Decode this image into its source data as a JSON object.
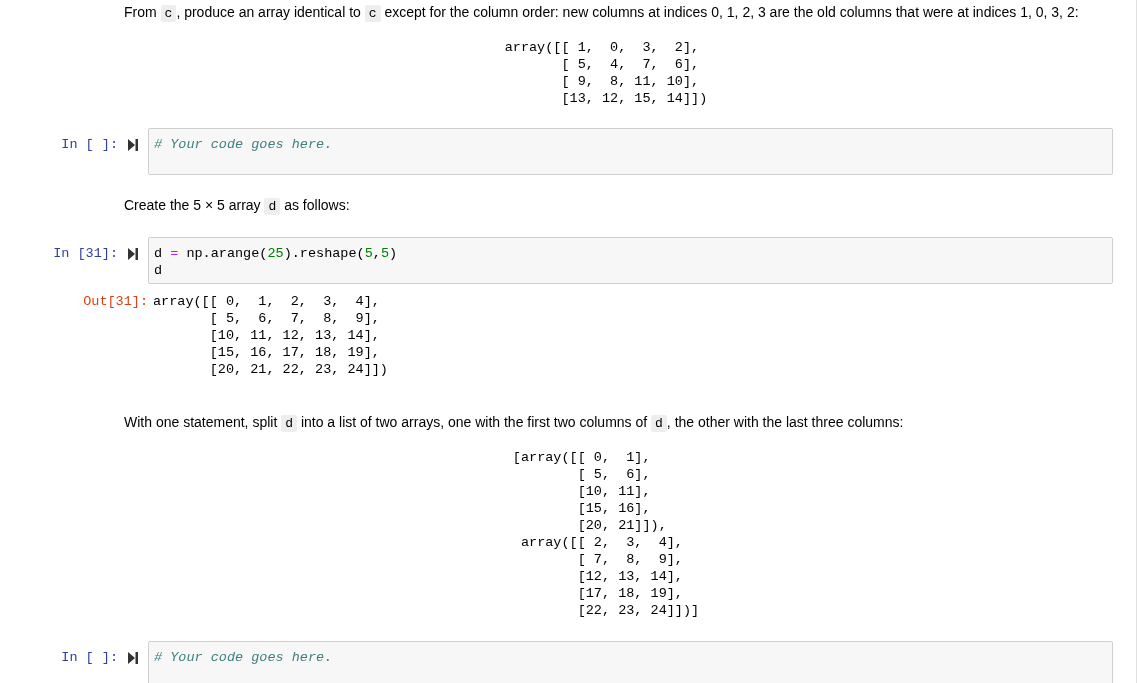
{
  "cells": [
    {
      "kind": "markdown",
      "parts": [
        {
          "kind": "text",
          "text": "From "
        },
        {
          "kind": "code",
          "text": "c"
        },
        {
          "kind": "text",
          "text": ", produce an array identical to "
        },
        {
          "kind": "code",
          "text": "c"
        },
        {
          "kind": "text",
          "text": " except for the column order: new columns at indices 0, 1, 2, 3 are the old columns that were at indices 1, 0, 3, 2:"
        }
      ],
      "block": [
        "array([[ 1,  0,  3,  2],",
        "       [ 5,  4,  7,  6],",
        "       [ 9,  8, 11, 10],",
        "       [13, 12, 15, 14]])"
      ]
    },
    {
      "kind": "code",
      "prompt": "In [ ]:",
      "lines": [
        [
          {
            "kind": "comment",
            "text": "# Your code goes here."
          }
        ]
      ]
    },
    {
      "kind": "markdown",
      "parts": [
        {
          "kind": "text",
          "text": "Create the 5 × 5 array "
        },
        {
          "kind": "code",
          "text": "d"
        },
        {
          "kind": "text",
          "text": " as follows:"
        }
      ]
    },
    {
      "kind": "code",
      "prompt": "In [31]:",
      "lines": [
        [
          {
            "kind": "plain",
            "text": "d "
          },
          {
            "kind": "op",
            "text": "="
          },
          {
            "kind": "plain",
            "text": " np.arange("
          },
          {
            "kind": "number",
            "text": "25"
          },
          {
            "kind": "plain",
            "text": ").reshape("
          },
          {
            "kind": "number",
            "text": "5"
          },
          {
            "kind": "plain",
            "text": ","
          },
          {
            "kind": "number",
            "text": "5"
          },
          {
            "kind": "plain",
            "text": ")"
          }
        ],
        [
          {
            "kind": "plain",
            "text": "d"
          }
        ]
      ]
    },
    {
      "kind": "output",
      "prompt": "Out[31]:",
      "lines": [
        "array([[ 0,  1,  2,  3,  4],",
        "       [ 5,  6,  7,  8,  9],",
        "       [10, 11, 12, 13, 14],",
        "       [15, 16, 17, 18, 19],",
        "       [20, 21, 22, 23, 24]])"
      ]
    },
    {
      "kind": "markdown",
      "parts": [
        {
          "kind": "text",
          "text": "With one statement, split "
        },
        {
          "kind": "code",
          "text": "d"
        },
        {
          "kind": "text",
          "text": " into a list of two arrays, one with the first two columns of "
        },
        {
          "kind": "code",
          "text": "d"
        },
        {
          "kind": "text",
          "text": ", the other with the last three columns:"
        }
      ],
      "block": [
        "[array([[ 0,  1],",
        "        [ 5,  6],",
        "        [10, 11],",
        "        [15, 16],",
        "        [20, 21]]),",
        " array([[ 2,  3,  4],",
        "        [ 7,  8,  9],",
        "        [12, 13, 14],",
        "        [17, 18, 19],",
        "        [22, 23, 24]])]"
      ]
    },
    {
      "kind": "code",
      "prompt": "In [ ]:",
      "lines": [
        [
          {
            "kind": "comment",
            "text": "# Your code goes here."
          }
        ]
      ]
    }
  ]
}
